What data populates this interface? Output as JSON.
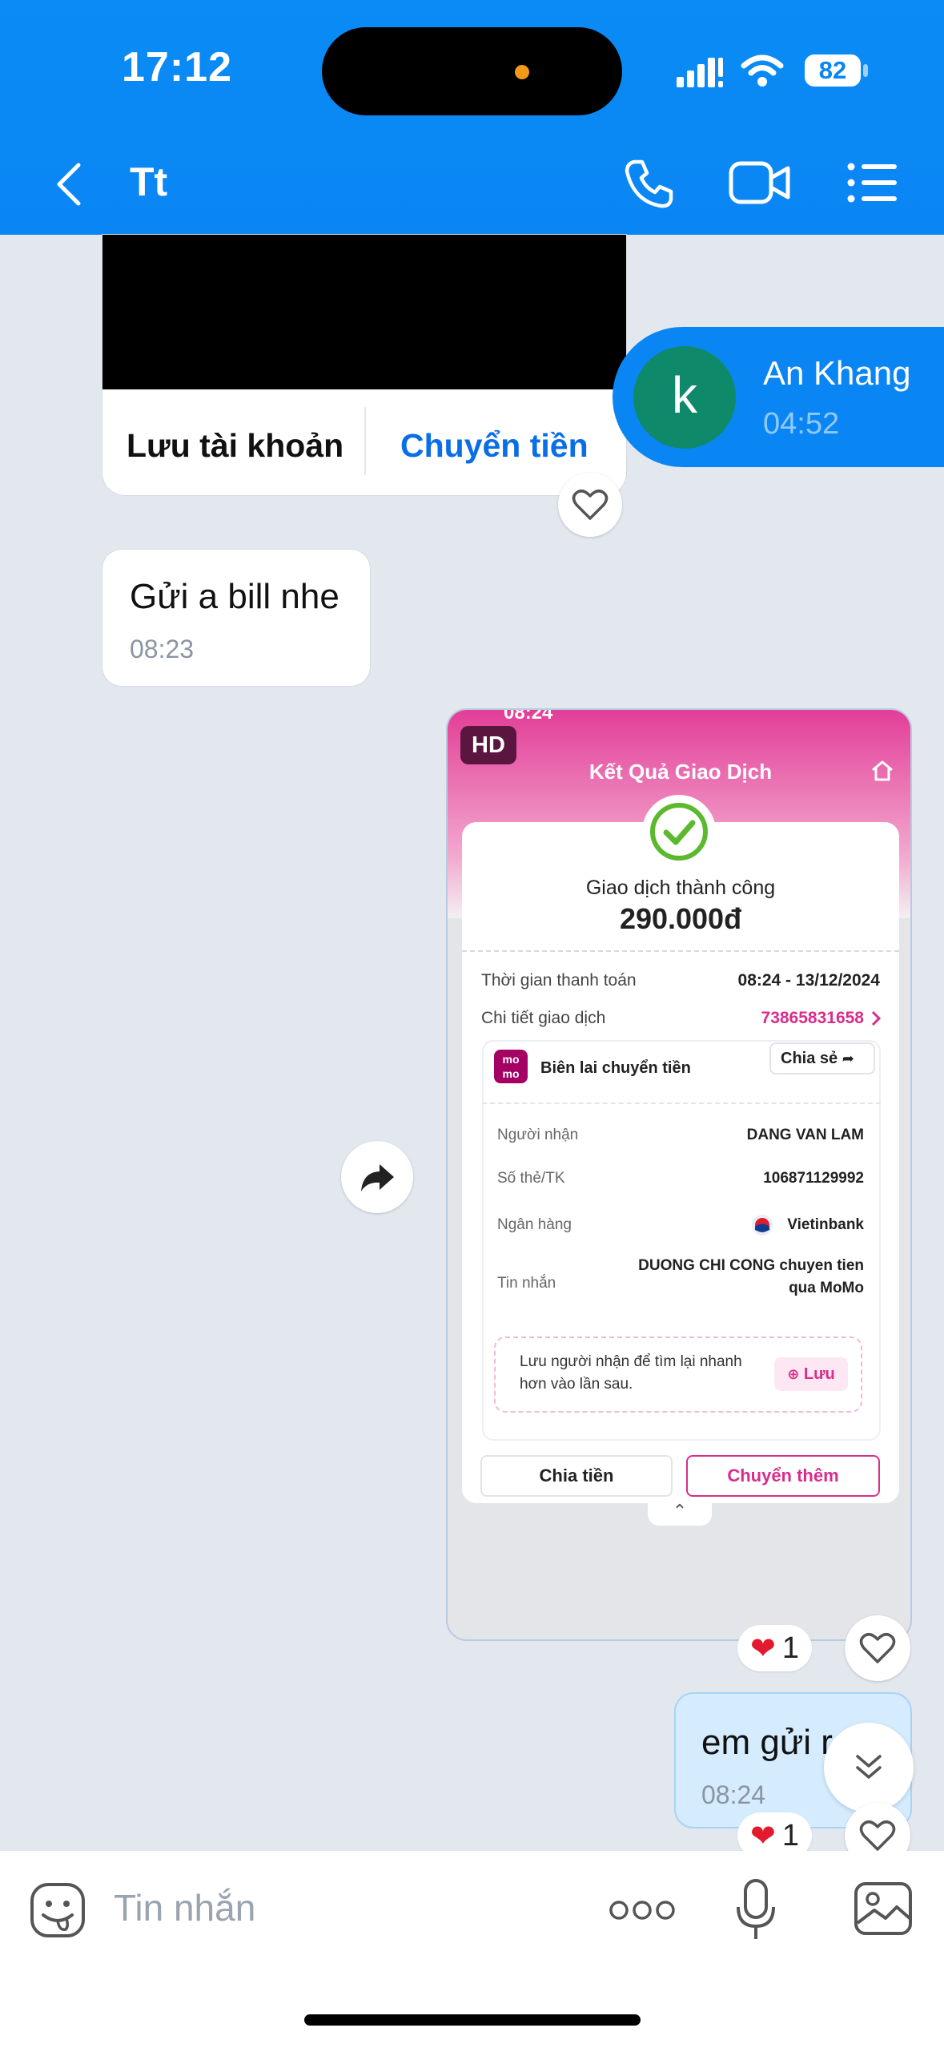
{
  "status_bar": {
    "time": "17:12",
    "battery": "82"
  },
  "header": {
    "title": "Tt"
  },
  "transfer_card": {
    "save_label": "Lưu tài khoản",
    "transfer_label": "Chuyển tiền"
  },
  "messages": {
    "incoming": {
      "text": "Gửi a bill nhe",
      "time": "08:23"
    },
    "outgoing": {
      "text": "em gửi r",
      "time": "08:24"
    }
  },
  "notification": {
    "avatar_letter": "k",
    "name": "An Khang",
    "time": "04:52"
  },
  "receipt": {
    "status_time": "08:24",
    "hd_badge": "HD",
    "title": "Kết Quả Giao Dịch",
    "status": "Giao dịch thành công",
    "amount": "290.000đ",
    "time_label": "Thời gian thanh toán",
    "time_value": "08:24 - 13/12/2024",
    "detail_label": "Chi tiết giao dịch",
    "detail_value": "73865831658",
    "momo_logo": "mo mo",
    "receipt_label": "Biên lai chuyển tiền",
    "share_label": "Chia sẻ",
    "recipient_label": "Người nhận",
    "recipient_value": "DANG VAN LAM",
    "account_label": "Số thẻ/TK",
    "account_value": "106871129992",
    "bank_label": "Ngân hàng",
    "bank_value": "Vietinbank",
    "message_label": "Tin nhắn",
    "message_value": "DUONG CHI CONG chuyen tien qua MoMo",
    "save_hint": "Lưu người nhận để tìm lại nhanh hơn vào lần sau.",
    "save_button": "Lưu",
    "split_button": "Chia tiền",
    "more_button": "Chuyển thêm"
  },
  "reactions": {
    "image_count": "1",
    "text_count": "1"
  },
  "composer": {
    "placeholder": "Tin nhắn"
  },
  "colors": {
    "header_blue": "#0a86f4",
    "momo_pink": "#d82d8b",
    "outgoing_bubble": "#d4ecfd"
  }
}
